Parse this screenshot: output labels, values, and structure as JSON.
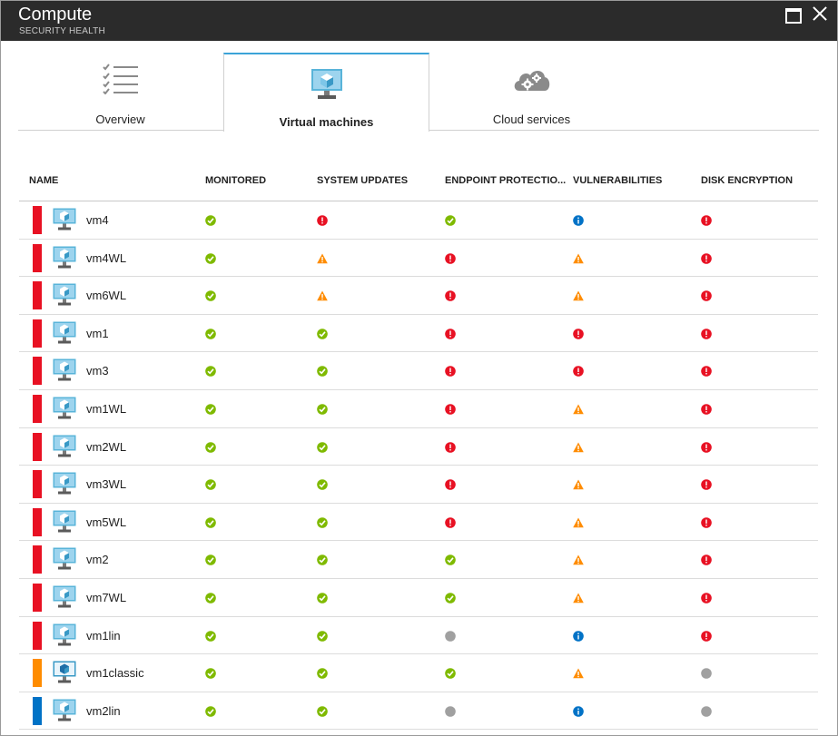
{
  "window": {
    "title": "Compute",
    "subtitle": "SECURITY HEALTH"
  },
  "tabs": [
    {
      "label": "Overview",
      "icon": "checklist-icon",
      "active": false
    },
    {
      "label": "Virtual machines",
      "icon": "virtual-machine-icon",
      "active": true
    },
    {
      "label": "Cloud services",
      "icon": "cloud-gears-icon",
      "active": false
    }
  ],
  "columns": [
    "NAME",
    "MONITORED",
    "SYSTEM UPDATES",
    "ENDPOINT PROTECTIO...",
    "VULNERABILITIES",
    "DISK ENCRYPTION"
  ],
  "colors": {
    "ok": "#7fba00",
    "error": "#e81123",
    "warning": "#ff8c00",
    "info": "#0072c6",
    "unknown": "#a0a0a0",
    "severity_high": "#e81123",
    "severity_medium": "#ff8c00",
    "severity_low": "#0072c6",
    "tab_accent": "#3ba3d8"
  },
  "rows": [
    {
      "name": "vm4",
      "severity": "high",
      "vm_type": "arm",
      "statuses": [
        "ok",
        "error",
        "ok",
        "info",
        "error"
      ]
    },
    {
      "name": "vm4WL",
      "severity": "high",
      "vm_type": "arm",
      "statuses": [
        "ok",
        "warning",
        "error",
        "warning",
        "error"
      ]
    },
    {
      "name": "vm6WL",
      "severity": "high",
      "vm_type": "arm",
      "statuses": [
        "ok",
        "warning",
        "error",
        "warning",
        "error"
      ]
    },
    {
      "name": "vm1",
      "severity": "high",
      "vm_type": "arm",
      "statuses": [
        "ok",
        "ok",
        "error",
        "error",
        "error"
      ]
    },
    {
      "name": "vm3",
      "severity": "high",
      "vm_type": "arm",
      "statuses": [
        "ok",
        "ok",
        "error",
        "error",
        "error"
      ]
    },
    {
      "name": "vm1WL",
      "severity": "high",
      "vm_type": "arm",
      "statuses": [
        "ok",
        "ok",
        "error",
        "warning",
        "error"
      ]
    },
    {
      "name": "vm2WL",
      "severity": "high",
      "vm_type": "arm",
      "statuses": [
        "ok",
        "ok",
        "error",
        "warning",
        "error"
      ]
    },
    {
      "name": "vm3WL",
      "severity": "high",
      "vm_type": "arm",
      "statuses": [
        "ok",
        "ok",
        "error",
        "warning",
        "error"
      ]
    },
    {
      "name": "vm5WL",
      "severity": "high",
      "vm_type": "arm",
      "statuses": [
        "ok",
        "ok",
        "error",
        "warning",
        "error"
      ]
    },
    {
      "name": "vm2",
      "severity": "high",
      "vm_type": "arm",
      "statuses": [
        "ok",
        "ok",
        "ok",
        "warning",
        "error"
      ]
    },
    {
      "name": "vm7WL",
      "severity": "high",
      "vm_type": "arm",
      "statuses": [
        "ok",
        "ok",
        "ok",
        "warning",
        "error"
      ]
    },
    {
      "name": "vm1lin",
      "severity": "high",
      "vm_type": "arm",
      "statuses": [
        "ok",
        "ok",
        "unknown",
        "info",
        "error"
      ]
    },
    {
      "name": "vm1classic",
      "severity": "medium",
      "vm_type": "classic",
      "statuses": [
        "ok",
        "ok",
        "ok",
        "warning",
        "unknown"
      ]
    },
    {
      "name": "vm2lin",
      "severity": "low",
      "vm_type": "arm",
      "statuses": [
        "ok",
        "ok",
        "unknown",
        "info",
        "unknown"
      ]
    }
  ]
}
